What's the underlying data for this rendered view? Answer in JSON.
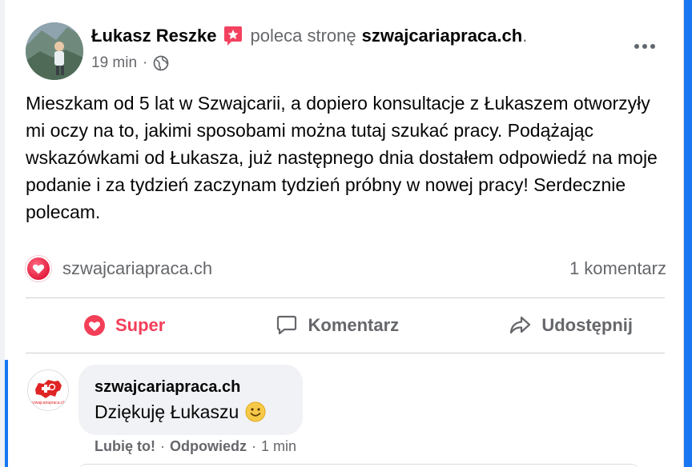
{
  "post": {
    "author": "Łukasz Reszke",
    "action_text": "poleca stronę",
    "page_name": "szwajcariapraca.ch",
    "period": ".",
    "time": "19 min",
    "dot": "·",
    "body": "Mieszkam od 5 lat w Szwajcarii, a dopiero konsultacje z Łukaszem otworzyły mi oczy na to, jakimi sposobami można tutaj szukać pracy. Podążając wskazówkami od Łukasza, już następnego dnia dostałem odpowiedź na moje podanie i za tydzień zaczynam tydzień próbny w nowej pracy! Serdecznie polecam."
  },
  "stats": {
    "reaction_label": "szwajcariapraca.ch",
    "comments_count": "1 komentarz"
  },
  "actions": {
    "like": "Super",
    "comment": "Komentarz",
    "share": "Udostępnij"
  },
  "comment": {
    "author": "szwajcariapraca.ch",
    "text": "Dziękuję Łukaszu",
    "like_label": "Lubię to!",
    "reply_label": "Odpowiedz",
    "sep": "·",
    "time": "1 min"
  },
  "logo": {
    "text": "szwajcariapraca.ch"
  },
  "colors": {
    "like_red": "#f33e58",
    "accent_blue": "#1877f2",
    "muted_text": "#65676b"
  }
}
